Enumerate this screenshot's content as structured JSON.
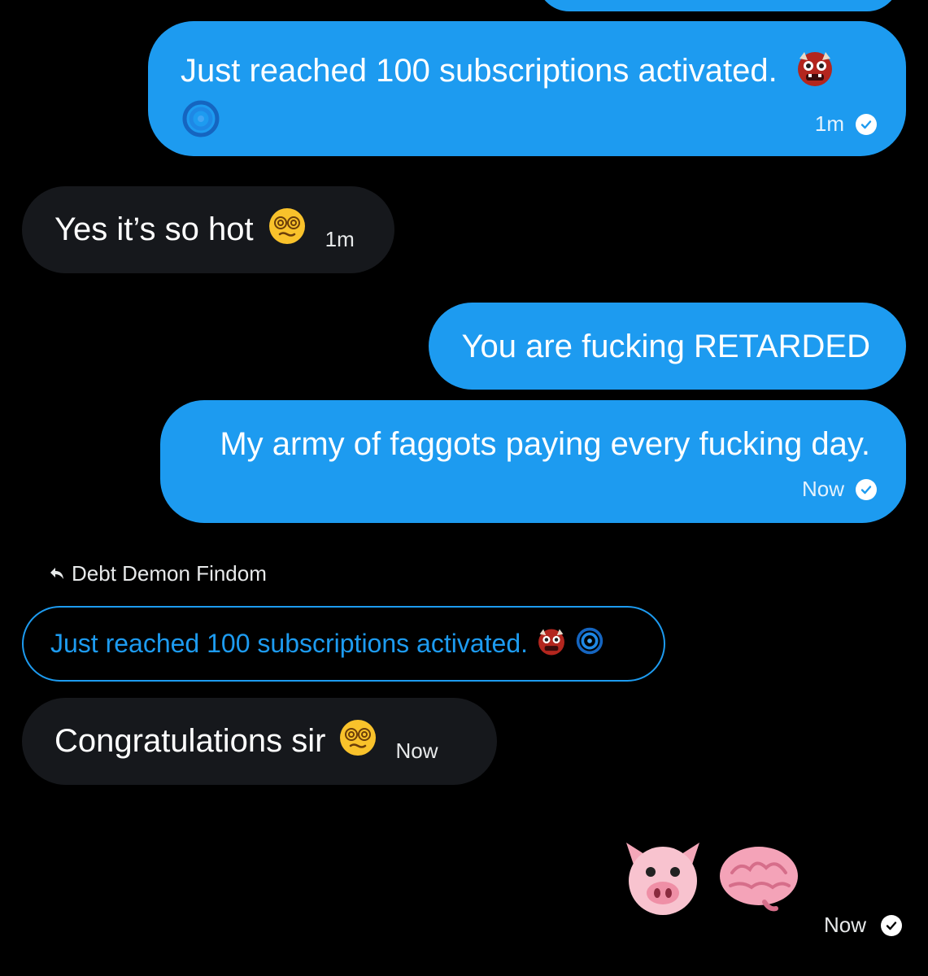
{
  "conversation": {
    "messages": [
      {
        "direction": "sent",
        "text": "Just reached 100 subscriptions activated.",
        "emojis": [
          "ogre-emoji",
          "cyclone-emoji"
        ],
        "time": "1m",
        "status": "read"
      },
      {
        "direction": "received",
        "text": "Yes it’s so hot",
        "emojis": [
          "face-with-spiral-eyes-emoji"
        ],
        "time": "1m"
      },
      {
        "direction": "sent",
        "text": "You are fucking RETARDED"
      },
      {
        "direction": "sent",
        "text": "My army of faggots paying every fucking day.",
        "time": "Now",
        "status": "read"
      },
      {
        "direction": "received",
        "reply_to": {
          "author": "Debt Demon Findom",
          "text": "Just reached 100 subscriptions activated.",
          "emojis": [
            "ogre-emoji",
            "cyclone-emoji"
          ]
        },
        "text": "Congratulations sir",
        "emojis": [
          "face-with-spiral-eyes-emoji"
        ],
        "time": "Now"
      },
      {
        "direction": "sent",
        "text": "",
        "emojis": [
          "pig-face-emoji",
          "brain-emoji"
        ],
        "time": "Now",
        "status": "read"
      }
    ]
  },
  "colors": {
    "background": "#000000",
    "sent_bubble": "#1d9bf0",
    "received_bubble": "#16181c",
    "accent": "#1d9bf0"
  }
}
